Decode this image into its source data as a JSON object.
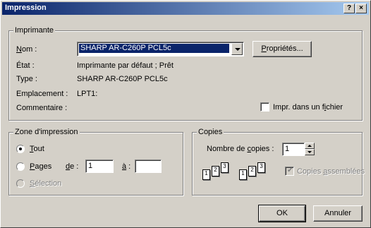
{
  "window": {
    "title": "Impression",
    "help_label": "?",
    "close_label": "×"
  },
  "printer": {
    "group_label": "Imprimante",
    "name_label": "Nom :",
    "name_value": "SHARP AR-C260P PCL5c",
    "properties_label": "Propriétés...",
    "status_label": "État :",
    "status_value": "Imprimante par défaut ; Prêt",
    "type_label": "Type :",
    "type_value": "SHARP AR-C260P PCL5c",
    "location_label": "Emplacement :",
    "location_value": "LPT1:",
    "comment_label": "Commentaire :",
    "print_to_file_label": "Impr. dans un fichier",
    "print_to_file_checked": false
  },
  "range": {
    "group_label": "Zone d'impression",
    "all_label": "Tout",
    "pages_label": "Pages",
    "from_label": "de :",
    "from_value": "1",
    "to_label": "à :",
    "to_value": "",
    "selection_label": "Sélection",
    "selected": "all"
  },
  "copies": {
    "group_label": "Copies",
    "count_label": "Nombre de copies :",
    "count_value": "1",
    "collate_label": "Copies assemblées",
    "collate_checked": true,
    "collate_enabled": false,
    "pages": [
      "1",
      "2",
      "3"
    ]
  },
  "actions": {
    "ok_label": "OK",
    "cancel_label": "Annuler"
  }
}
